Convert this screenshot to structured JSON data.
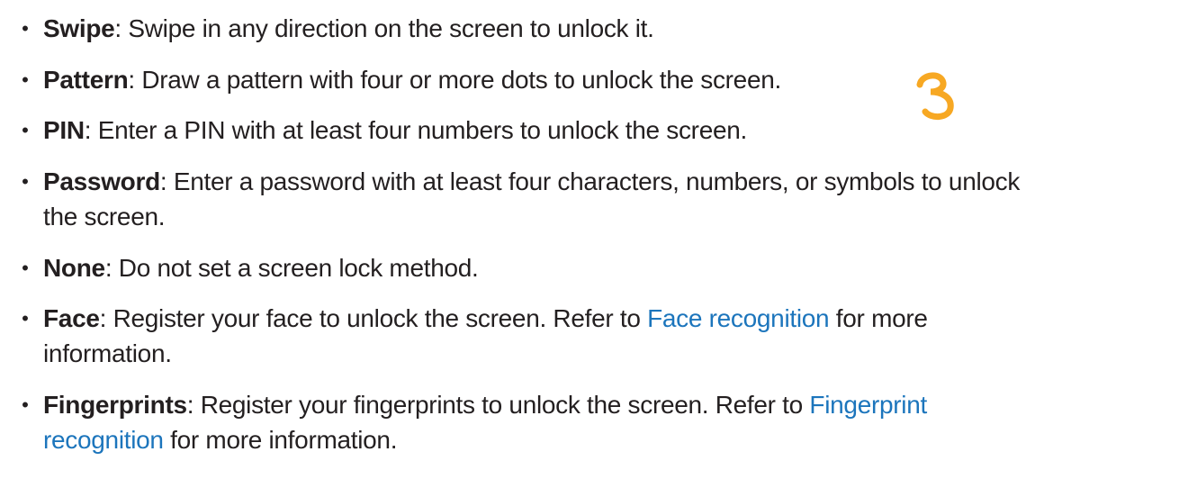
{
  "items": [
    {
      "term": "Swipe",
      "lines": [
        ": Swipe in any direction on the screen to unlock it."
      ]
    },
    {
      "term": "Pattern",
      "lines": [
        ": Draw a pattern with four or more dots to unlock the screen."
      ]
    },
    {
      "term": "PIN",
      "lines": [
        ": Enter a PIN with at least four numbers to unlock the screen."
      ]
    },
    {
      "term": "Password",
      "lines": [
        ": Enter a password with at least four characters, numbers, or symbols to unlock",
        "the screen."
      ]
    },
    {
      "term": "None",
      "lines": [
        ": Do not set a screen lock method."
      ]
    },
    {
      "term": "Face",
      "line1_pre": ": Register your face to unlock the screen. Refer to ",
      "link": "Face recognition",
      "line1_post": " for more",
      "line2": "information."
    },
    {
      "term": "Fingerprints",
      "line1_pre": ": Register your fingerprints to unlock the screen. Refer to ",
      "link_part1": "Fingerprint",
      "link_part2": "recognition",
      "line2_post": " for more information."
    }
  ],
  "bullet_char": "•",
  "colors": {
    "text": "#231f20",
    "link": "#1c75bc",
    "mark": "#f7a823"
  }
}
